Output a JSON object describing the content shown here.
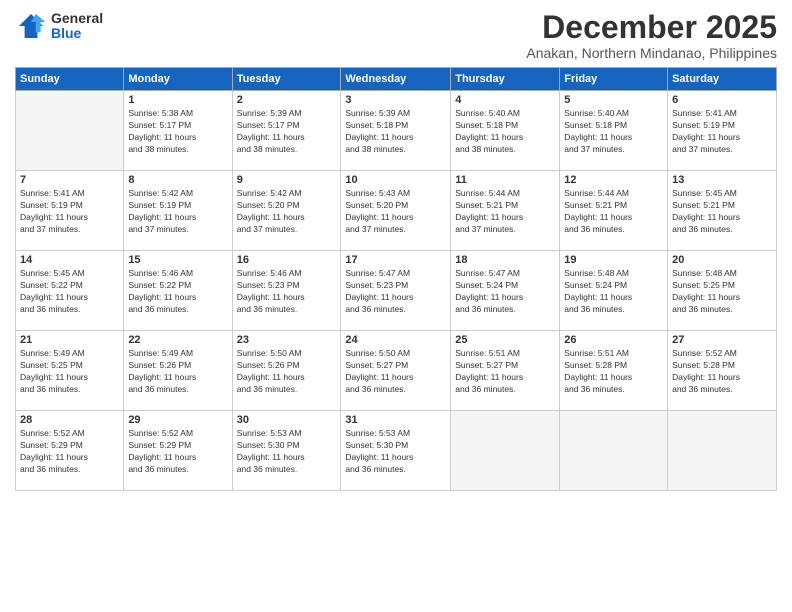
{
  "logo": {
    "general": "General",
    "blue": "Blue"
  },
  "title": "December 2025",
  "subtitle": "Anakan, Northern Mindanao, Philippines",
  "days_header": [
    "Sunday",
    "Monday",
    "Tuesday",
    "Wednesday",
    "Thursday",
    "Friday",
    "Saturday"
  ],
  "weeks": [
    [
      {
        "num": "",
        "sunrise": "",
        "sunset": "",
        "daylight": ""
      },
      {
        "num": "1",
        "sunrise": "Sunrise: 5:38 AM",
        "sunset": "Sunset: 5:17 PM",
        "daylight": "Daylight: 11 hours and 38 minutes."
      },
      {
        "num": "2",
        "sunrise": "Sunrise: 5:39 AM",
        "sunset": "Sunset: 5:17 PM",
        "daylight": "Daylight: 11 hours and 38 minutes."
      },
      {
        "num": "3",
        "sunrise": "Sunrise: 5:39 AM",
        "sunset": "Sunset: 5:18 PM",
        "daylight": "Daylight: 11 hours and 38 minutes."
      },
      {
        "num": "4",
        "sunrise": "Sunrise: 5:40 AM",
        "sunset": "Sunset: 5:18 PM",
        "daylight": "Daylight: 11 hours and 38 minutes."
      },
      {
        "num": "5",
        "sunrise": "Sunrise: 5:40 AM",
        "sunset": "Sunset: 5:18 PM",
        "daylight": "Daylight: 11 hours and 37 minutes."
      },
      {
        "num": "6",
        "sunrise": "Sunrise: 5:41 AM",
        "sunset": "Sunset: 5:19 PM",
        "daylight": "Daylight: 11 hours and 37 minutes."
      }
    ],
    [
      {
        "num": "7",
        "sunrise": "Sunrise: 5:41 AM",
        "sunset": "Sunset: 5:19 PM",
        "daylight": "Daylight: 11 hours and 37 minutes."
      },
      {
        "num": "8",
        "sunrise": "Sunrise: 5:42 AM",
        "sunset": "Sunset: 5:19 PM",
        "daylight": "Daylight: 11 hours and 37 minutes."
      },
      {
        "num": "9",
        "sunrise": "Sunrise: 5:42 AM",
        "sunset": "Sunset: 5:20 PM",
        "daylight": "Daylight: 11 hours and 37 minutes."
      },
      {
        "num": "10",
        "sunrise": "Sunrise: 5:43 AM",
        "sunset": "Sunset: 5:20 PM",
        "daylight": "Daylight: 11 hours and 37 minutes."
      },
      {
        "num": "11",
        "sunrise": "Sunrise: 5:44 AM",
        "sunset": "Sunset: 5:21 PM",
        "daylight": "Daylight: 11 hours and 37 minutes."
      },
      {
        "num": "12",
        "sunrise": "Sunrise: 5:44 AM",
        "sunset": "Sunset: 5:21 PM",
        "daylight": "Daylight: 11 hours and 36 minutes."
      },
      {
        "num": "13",
        "sunrise": "Sunrise: 5:45 AM",
        "sunset": "Sunset: 5:21 PM",
        "daylight": "Daylight: 11 hours and 36 minutes."
      }
    ],
    [
      {
        "num": "14",
        "sunrise": "Sunrise: 5:45 AM",
        "sunset": "Sunset: 5:22 PM",
        "daylight": "Daylight: 11 hours and 36 minutes."
      },
      {
        "num": "15",
        "sunrise": "Sunrise: 5:46 AM",
        "sunset": "Sunset: 5:22 PM",
        "daylight": "Daylight: 11 hours and 36 minutes."
      },
      {
        "num": "16",
        "sunrise": "Sunrise: 5:46 AM",
        "sunset": "Sunset: 5:23 PM",
        "daylight": "Daylight: 11 hours and 36 minutes."
      },
      {
        "num": "17",
        "sunrise": "Sunrise: 5:47 AM",
        "sunset": "Sunset: 5:23 PM",
        "daylight": "Daylight: 11 hours and 36 minutes."
      },
      {
        "num": "18",
        "sunrise": "Sunrise: 5:47 AM",
        "sunset": "Sunset: 5:24 PM",
        "daylight": "Daylight: 11 hours and 36 minutes."
      },
      {
        "num": "19",
        "sunrise": "Sunrise: 5:48 AM",
        "sunset": "Sunset: 5:24 PM",
        "daylight": "Daylight: 11 hours and 36 minutes."
      },
      {
        "num": "20",
        "sunrise": "Sunrise: 5:48 AM",
        "sunset": "Sunset: 5:25 PM",
        "daylight": "Daylight: 11 hours and 36 minutes."
      }
    ],
    [
      {
        "num": "21",
        "sunrise": "Sunrise: 5:49 AM",
        "sunset": "Sunset: 5:25 PM",
        "daylight": "Daylight: 11 hours and 36 minutes."
      },
      {
        "num": "22",
        "sunrise": "Sunrise: 5:49 AM",
        "sunset": "Sunset: 5:26 PM",
        "daylight": "Daylight: 11 hours and 36 minutes."
      },
      {
        "num": "23",
        "sunrise": "Sunrise: 5:50 AM",
        "sunset": "Sunset: 5:26 PM",
        "daylight": "Daylight: 11 hours and 36 minutes."
      },
      {
        "num": "24",
        "sunrise": "Sunrise: 5:50 AM",
        "sunset": "Sunset: 5:27 PM",
        "daylight": "Daylight: 11 hours and 36 minutes."
      },
      {
        "num": "25",
        "sunrise": "Sunrise: 5:51 AM",
        "sunset": "Sunset: 5:27 PM",
        "daylight": "Daylight: 11 hours and 36 minutes."
      },
      {
        "num": "26",
        "sunrise": "Sunrise: 5:51 AM",
        "sunset": "Sunset: 5:28 PM",
        "daylight": "Daylight: 11 hours and 36 minutes."
      },
      {
        "num": "27",
        "sunrise": "Sunrise: 5:52 AM",
        "sunset": "Sunset: 5:28 PM",
        "daylight": "Daylight: 11 hours and 36 minutes."
      }
    ],
    [
      {
        "num": "28",
        "sunrise": "Sunrise: 5:52 AM",
        "sunset": "Sunset: 5:29 PM",
        "daylight": "Daylight: 11 hours and 36 minutes."
      },
      {
        "num": "29",
        "sunrise": "Sunrise: 5:52 AM",
        "sunset": "Sunset: 5:29 PM",
        "daylight": "Daylight: 11 hours and 36 minutes."
      },
      {
        "num": "30",
        "sunrise": "Sunrise: 5:53 AM",
        "sunset": "Sunset: 5:30 PM",
        "daylight": "Daylight: 11 hours and 36 minutes."
      },
      {
        "num": "31",
        "sunrise": "Sunrise: 5:53 AM",
        "sunset": "Sunset: 5:30 PM",
        "daylight": "Daylight: 11 hours and 36 minutes."
      },
      {
        "num": "",
        "sunrise": "",
        "sunset": "",
        "daylight": ""
      },
      {
        "num": "",
        "sunrise": "",
        "sunset": "",
        "daylight": ""
      },
      {
        "num": "",
        "sunrise": "",
        "sunset": "",
        "daylight": ""
      }
    ]
  ]
}
